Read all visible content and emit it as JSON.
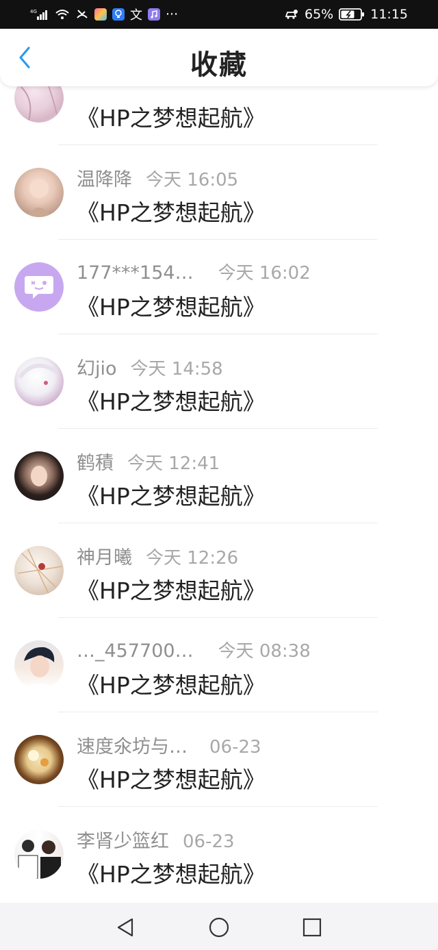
{
  "status_bar": {
    "network": "4G",
    "battery": "65%",
    "time": "11:15",
    "more": "···"
  },
  "header": {
    "title": "收藏"
  },
  "items": [
    {
      "name": "",
      "time": "",
      "content": "《HP之梦想起航》"
    },
    {
      "name": "温降降",
      "time": "今天 16:05",
      "content": "《HP之梦想起航》"
    },
    {
      "name": "177***154…",
      "time": "今天 16:02",
      "content": "《HP之梦想起航》"
    },
    {
      "name": "幻jio",
      "time": "今天 14:58",
      "content": "《HP之梦想起航》"
    },
    {
      "name": "鹤積",
      "time": "今天 12:41",
      "content": "《HP之梦想起航》"
    },
    {
      "name": "神月曦",
      "time": "今天 12:26",
      "content": "《HP之梦想起航》"
    },
    {
      "name": "…_457700…",
      "time": "今天 08:38",
      "content": "《HP之梦想起航》"
    },
    {
      "name": "速度氽坊与…",
      "time": "06-23",
      "content": "《HP之梦想起航》"
    },
    {
      "name": "李肾少篮红",
      "time": "06-23",
      "content": "《HP之梦想起航》"
    }
  ],
  "colors": {
    "accent": "#2a9bf0",
    "title": "#222222",
    "meta": "#9a9a9a"
  }
}
